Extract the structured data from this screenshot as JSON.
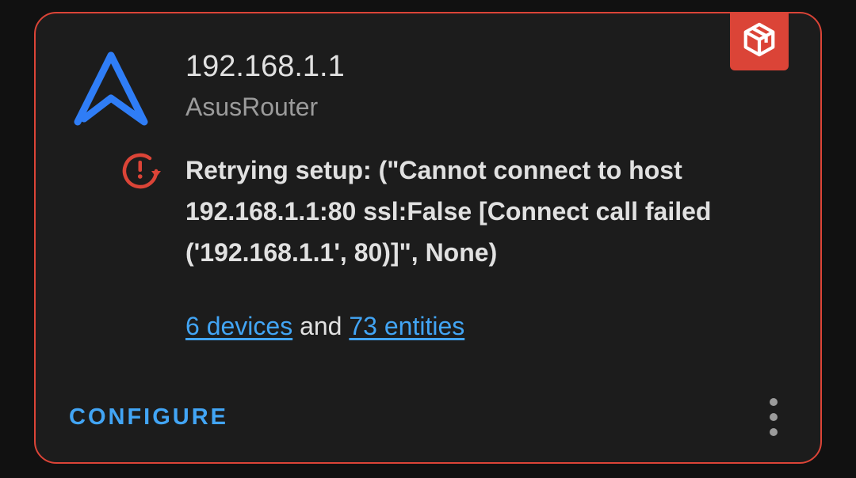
{
  "integration": {
    "title": "192.168.1.1",
    "subtitle": "AsusRouter",
    "status_message": "Retrying setup: (\"Cannot connect to host 192.168.1.1:80 ssl:False [Connect call failed ('192.168.1.1', 80)]\", None)",
    "devices_link": "6 devices",
    "and_text": " and ",
    "entities_link": "73 entities"
  },
  "actions": {
    "configure_label": "CONFIGURE"
  },
  "icons": {
    "logo": "asusrouter-logo-icon",
    "badge": "custom-integration-cube-icon",
    "status": "retry-alert-icon",
    "menu": "more-vertical-icon"
  },
  "colors": {
    "accent": "#42a5f5",
    "error": "#db4437",
    "logo_blue": "#2f7df6",
    "card_bg": "#1c1c1c"
  }
}
